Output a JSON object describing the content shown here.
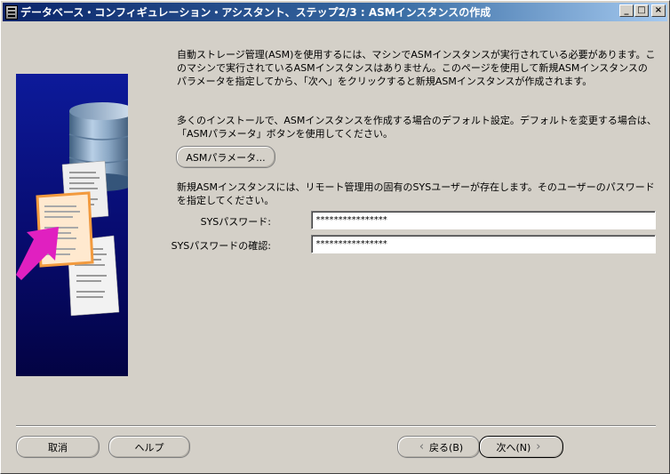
{
  "window": {
    "title": "データベース・コンフィギュレーション・アシスタント、ステップ2/3 : ASMインスタンスの作成",
    "controls": {
      "minimize": "_",
      "maximize": "□",
      "close": "×"
    }
  },
  "description": {
    "para1": "自動ストレージ管理(ASM)を使用するには、マシンでASMインスタンスが実行されている必要があります。このマシンで実行されているASMインスタンスはありません。このページを使用して新規ASMインスタンスのパラメータを指定してから、「次へ」をクリックすると新規ASMインスタンスが作成されます。",
    "para2": "多くのインストールで、ASMインスタンスを作成する場合のデフォルト設定。デフォルトを変更する場合は、「ASMパラメータ」ボタンを使用してください。",
    "para3": "新規ASMインスタンスには、リモート管理用の固有のSYSユーザーが存在します。そのユーザーのパスワードを指定してください。"
  },
  "asm_params_button": "ASMパラメータ...",
  "form": {
    "sys_password_label": "SYSパスワード:",
    "sys_password_value": "****************",
    "sys_password_confirm_label": "SYSパスワードの確認:",
    "sys_password_confirm_value": "****************"
  },
  "footer": {
    "cancel": "取消",
    "help": "ヘルプ",
    "back": "戻る(B)",
    "next": "次へ(N)"
  },
  "icons": {
    "app": "app-icon",
    "back_arrow": "‹",
    "next_arrow": "›"
  },
  "colors": {
    "titlebar_start": "#0a246a",
    "titlebar_end": "#a6caf0",
    "side_panel": "#070b6e",
    "accent_arrow": "#e020c0"
  }
}
